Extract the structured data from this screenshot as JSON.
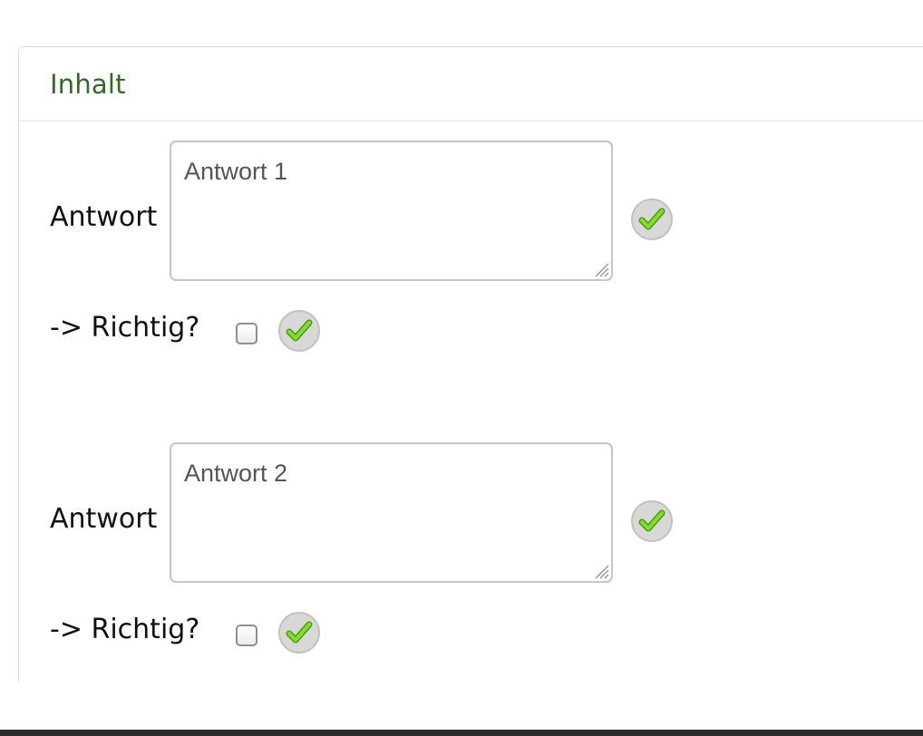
{
  "panel": {
    "title": "Inhalt"
  },
  "answers": [
    {
      "label": "Antwort",
      "value": "Antwort 1",
      "correct_label": "-> Richtig?",
      "correct_checked": false
    },
    {
      "label": "Antwort",
      "value": "Antwort 2",
      "correct_label": "-> Richtig?",
      "correct_checked": false
    }
  ],
  "icons": {
    "confirm": "checkmark-icon",
    "check_color": "#6fd11e",
    "badge_color": "#d8d8d8"
  }
}
